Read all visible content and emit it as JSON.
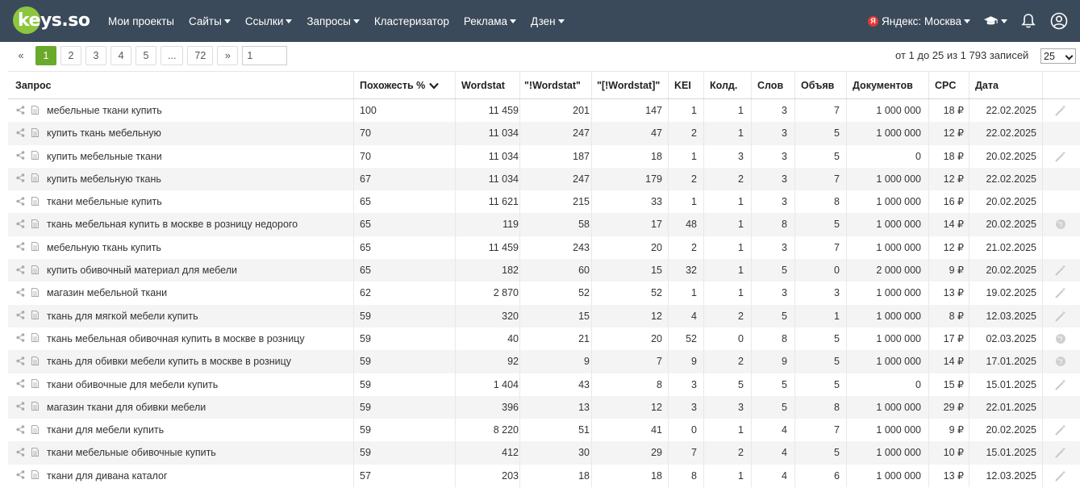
{
  "brand": {
    "logo_text": "keys.so"
  },
  "nav": {
    "items": [
      {
        "label": "Мои проекты",
        "caret": false
      },
      {
        "label": "Сайты",
        "caret": true
      },
      {
        "label": "Ссылки",
        "caret": true
      },
      {
        "label": "Запросы",
        "caret": true
      },
      {
        "label": "Кластеризатор",
        "caret": false
      },
      {
        "label": "Реклама",
        "caret": true
      },
      {
        "label": "Дзен",
        "caret": true
      }
    ],
    "region": "Яндекс: Москва",
    "region_icon": "Я"
  },
  "pagination": {
    "prev": "«",
    "pages": [
      "1",
      "2",
      "3",
      "4",
      "5",
      "...",
      "72"
    ],
    "active_page": "1",
    "next": "»",
    "page_input": "1",
    "records_text": "от 1 до 25 из 1 793 записей",
    "per_page": "25"
  },
  "table": {
    "headers": {
      "query": "Запрос",
      "similarity": "Похожесть %",
      "wordstat": "Wordstat",
      "wordstat_excl": "\"!Wordstat\"",
      "wordstat_brackets": "\"[!Wordstat]\"",
      "kei": "KEI",
      "kold": "Колд.",
      "slov": "Слов",
      "obyav": "Объяв",
      "docs": "Документов",
      "cpc": "CPC",
      "date": "Дата"
    },
    "rows": [
      {
        "query": "мебельные ткани купить",
        "similarity": "100",
        "wordstat": "11 459",
        "ws_excl": "201",
        "ws_br": "147",
        "kei": "1",
        "kold": "1",
        "slov": "3",
        "obyav": "7",
        "docs": "1 000 000",
        "cpc": "18 ₽",
        "date": "22.02.2025",
        "tail": "wand"
      },
      {
        "query": "купить ткань мебельную",
        "similarity": "70",
        "wordstat": "11 034",
        "ws_excl": "247",
        "ws_br": "47",
        "kei": "2",
        "kold": "1",
        "slov": "3",
        "obyav": "5",
        "docs": "1 000 000",
        "cpc": "12 ₽",
        "date": "22.02.2025",
        "tail": ""
      },
      {
        "query": "купить мебельные ткани",
        "similarity": "70",
        "wordstat": "11 034",
        "ws_excl": "187",
        "ws_br": "18",
        "kei": "1",
        "kold": "3",
        "slov": "3",
        "obyav": "5",
        "docs": "0",
        "cpc": "18 ₽",
        "date": "20.02.2025",
        "tail": "wand"
      },
      {
        "query": "купить мебельную ткань",
        "similarity": "67",
        "wordstat": "11 034",
        "ws_excl": "247",
        "ws_br": "179",
        "kei": "2",
        "kold": "2",
        "slov": "3",
        "obyav": "7",
        "docs": "1 000 000",
        "cpc": "12 ₽",
        "date": "22.02.2025",
        "tail": ""
      },
      {
        "query": "ткани мебельные купить",
        "similarity": "65",
        "wordstat": "11 621",
        "ws_excl": "215",
        "ws_br": "33",
        "kei": "1",
        "kold": "1",
        "slov": "3",
        "obyav": "8",
        "docs": "1 000 000",
        "cpc": "16 ₽",
        "date": "20.02.2025",
        "tail": ""
      },
      {
        "query": "ткань мебельная купить в москве в розницу недорого",
        "similarity": "65",
        "wordstat": "119",
        "ws_excl": "58",
        "ws_br": "17",
        "kei": "48",
        "kold": "1",
        "slov": "8",
        "obyav": "5",
        "docs": "1 000 000",
        "cpc": "14 ₽",
        "date": "20.02.2025",
        "tail": "globe"
      },
      {
        "query": "мебельную ткань купить",
        "similarity": "65",
        "wordstat": "11 459",
        "ws_excl": "243",
        "ws_br": "20",
        "kei": "2",
        "kold": "1",
        "slov": "3",
        "obyav": "7",
        "docs": "1 000 000",
        "cpc": "12 ₽",
        "date": "21.02.2025",
        "tail": ""
      },
      {
        "query": "купить обивочный материал для мебели",
        "similarity": "65",
        "wordstat": "182",
        "ws_excl": "60",
        "ws_br": "15",
        "kei": "32",
        "kold": "1",
        "slov": "5",
        "obyav": "0",
        "docs": "2 000 000",
        "cpc": "9 ₽",
        "date": "20.02.2025",
        "tail": "wand"
      },
      {
        "query": "магазин мебельной ткани",
        "similarity": "62",
        "wordstat": "2 870",
        "ws_excl": "52",
        "ws_br": "52",
        "kei": "1",
        "kold": "1",
        "slov": "3",
        "obyav": "3",
        "docs": "1 000 000",
        "cpc": "13 ₽",
        "date": "19.02.2025",
        "tail": "wand"
      },
      {
        "query": "ткань для мягкой мебели купить",
        "similarity": "59",
        "wordstat": "320",
        "ws_excl": "15",
        "ws_br": "12",
        "kei": "4",
        "kold": "2",
        "slov": "5",
        "obyav": "1",
        "docs": "1 000 000",
        "cpc": "8 ₽",
        "date": "12.03.2025",
        "tail": "wand"
      },
      {
        "query": "ткань мебельная обивочная купить в москве в розницу",
        "similarity": "59",
        "wordstat": "40",
        "ws_excl": "21",
        "ws_br": "20",
        "kei": "52",
        "kold": "0",
        "slov": "8",
        "obyav": "5",
        "docs": "1 000 000",
        "cpc": "17 ₽",
        "date": "02.03.2025",
        "tail": "globe"
      },
      {
        "query": "ткань для обивки мебели купить в москве в розницу",
        "similarity": "59",
        "wordstat": "92",
        "ws_excl": "9",
        "ws_br": "7",
        "kei": "9",
        "kold": "2",
        "slov": "9",
        "obyav": "5",
        "docs": "1 000 000",
        "cpc": "14 ₽",
        "date": "17.01.2025",
        "tail": "globe"
      },
      {
        "query": "ткани обивочные для мебели купить",
        "similarity": "59",
        "wordstat": "1 404",
        "ws_excl": "43",
        "ws_br": "8",
        "kei": "3",
        "kold": "5",
        "slov": "5",
        "obyav": "5",
        "docs": "0",
        "cpc": "15 ₽",
        "date": "15.01.2025",
        "tail": "wand"
      },
      {
        "query": "магазин ткани для обивки мебели",
        "similarity": "59",
        "wordstat": "396",
        "ws_excl": "13",
        "ws_br": "12",
        "kei": "3",
        "kold": "3",
        "slov": "5",
        "obyav": "8",
        "docs": "1 000 000",
        "cpc": "29 ₽",
        "date": "22.01.2025",
        "tail": ""
      },
      {
        "query": "ткани для мебели купить",
        "similarity": "59",
        "wordstat": "8 220",
        "ws_excl": "51",
        "ws_br": "41",
        "kei": "0",
        "kold": "1",
        "slov": "4",
        "obyav": "7",
        "docs": "1 000 000",
        "cpc": "9 ₽",
        "date": "20.02.2025",
        "tail": "wand"
      },
      {
        "query": "ткани мебельные обивочные купить",
        "similarity": "59",
        "wordstat": "412",
        "ws_excl": "30",
        "ws_br": "29",
        "kei": "7",
        "kold": "2",
        "slov": "4",
        "obyav": "5",
        "docs": "1 000 000",
        "cpc": "10 ₽",
        "date": "15.01.2025",
        "tail": "wand"
      },
      {
        "query": "ткани для дивана каталог",
        "similarity": "57",
        "wordstat": "203",
        "ws_excl": "18",
        "ws_br": "18",
        "kei": "8",
        "kold": "1",
        "slov": "4",
        "obyav": "6",
        "docs": "1 000 000",
        "cpc": "13 ₽",
        "date": "12.03.2025",
        "tail": "wand"
      }
    ]
  }
}
